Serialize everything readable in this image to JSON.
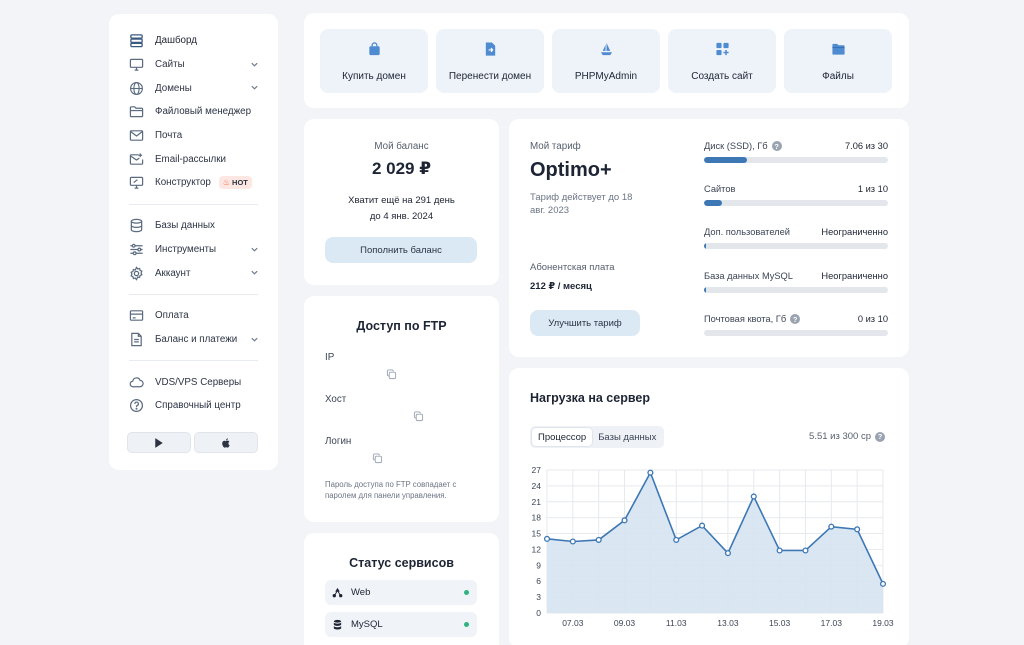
{
  "sidebar": {
    "items": [
      {
        "label": "Дашборд",
        "icon": "dashboard-icon"
      },
      {
        "label": "Сайты",
        "icon": "monitor-icon"
      },
      {
        "label": "Домены",
        "icon": "globe-icon"
      },
      {
        "label": "Файловый менеджер",
        "icon": "folder-icon"
      },
      {
        "label": "Почта",
        "icon": "mail-icon"
      },
      {
        "label": "Email-рассылки",
        "icon": "mail-send-icon"
      },
      {
        "label": "Конструктор",
        "icon": "constructor-icon",
        "badge": "HOT"
      },
      {
        "label": "Базы данных",
        "icon": "database-icon"
      },
      {
        "label": "Инструменты",
        "icon": "sliders-icon"
      },
      {
        "label": "Аккаунт",
        "icon": "gear-icon"
      },
      {
        "label": "Оплата",
        "icon": "card-icon"
      },
      {
        "label": "Баланс и платежи",
        "icon": "document-icon"
      },
      {
        "label": "VDS/VPS Серверы",
        "icon": "cloud-icon"
      },
      {
        "label": "Справочный центр",
        "icon": "help-icon"
      }
    ]
  },
  "quick_actions": [
    {
      "label": "Купить домен",
      "icon": "shopping-bag-icon"
    },
    {
      "label": "Перенести домен",
      "icon": "file-transfer-icon"
    },
    {
      "label": "PHPMyAdmin",
      "icon": "sailboat-icon"
    },
    {
      "label": "Создать сайт",
      "icon": "add-grid-icon"
    },
    {
      "label": "Файлы",
      "icon": "folder-icon"
    }
  ],
  "balance": {
    "title": "Мой баланс",
    "amount": "2 029 ₽",
    "enough_line1": "Хватит ещё на 291 день",
    "enough_line2": "до 4 янв. 2024",
    "button": "Пополнить баланс"
  },
  "ftp": {
    "title": "Доступ по FTP",
    "fields": [
      "IP",
      "Хост",
      "Логин"
    ],
    "note": "Пароль доступа по FTP совпадает с паролем для панели управления."
  },
  "services": {
    "title": "Статус сервисов",
    "items": [
      {
        "label": "Web",
        "icon": "network-icon",
        "status_color": "#2fb380"
      },
      {
        "label": "MySQL",
        "icon": "database-icon",
        "status_color": "#2fb380"
      }
    ]
  },
  "tariff": {
    "title": "Мой тариф",
    "plan": "Optimo+",
    "valid": "Тариф действует до 18 авг. 2023",
    "fee_label": "Абонентская плата",
    "fee": "212 ₽ / месяц",
    "button": "Улучшить тариф",
    "limits": [
      {
        "label": "Диск (SSD), Гб",
        "value": "7.06 из 30",
        "fraction": 0.235,
        "help": true
      },
      {
        "label": "Сайтов",
        "value": "1 из 10",
        "fraction": 0.1,
        "help": false
      },
      {
        "label": "Доп. пользователей",
        "value": "Неограниченно",
        "fraction": 0.01,
        "help": false
      },
      {
        "label": "База данных MySQL",
        "value": "Неограниченно",
        "fraction": 0.01,
        "help": false
      },
      {
        "label": "Почтовая квота, Гб",
        "value": "0 из 10",
        "fraction": 0,
        "help": true
      }
    ]
  },
  "load": {
    "title": "Нагрузка на сервер",
    "tabs": [
      "Процессор",
      "Базы данных"
    ],
    "active_tab": 0,
    "usage": "5.51 из 300 cp"
  },
  "chart_data": {
    "type": "area",
    "x": [
      "06.03",
      "07.03",
      "08.03",
      "09.03",
      "10.03",
      "11.03",
      "12.03",
      "13.03",
      "14.03",
      "15.03",
      "16.03",
      "17.03",
      "18.03",
      "19.03"
    ],
    "x_tick_labels": [
      "07.03",
      "09.03",
      "11.03",
      "13.03",
      "15.03",
      "17.03",
      "19.03"
    ],
    "values": [
      14,
      13.5,
      13.8,
      17.5,
      26.5,
      13.8,
      16.5,
      11.3,
      22,
      11.8,
      11.8,
      16.3,
      15.8,
      5.5
    ],
    "ylim": [
      0,
      27
    ],
    "yticks": [
      0,
      3,
      6,
      9,
      12,
      15,
      18,
      21,
      24,
      27
    ],
    "grid": true,
    "colors": {
      "line": "#3d77b4",
      "fill": "#d4e3f1"
    }
  },
  "colors": {
    "accent": "#3d77b4",
    "light_button": "#dbe9f5",
    "hot": "#f05a28"
  }
}
